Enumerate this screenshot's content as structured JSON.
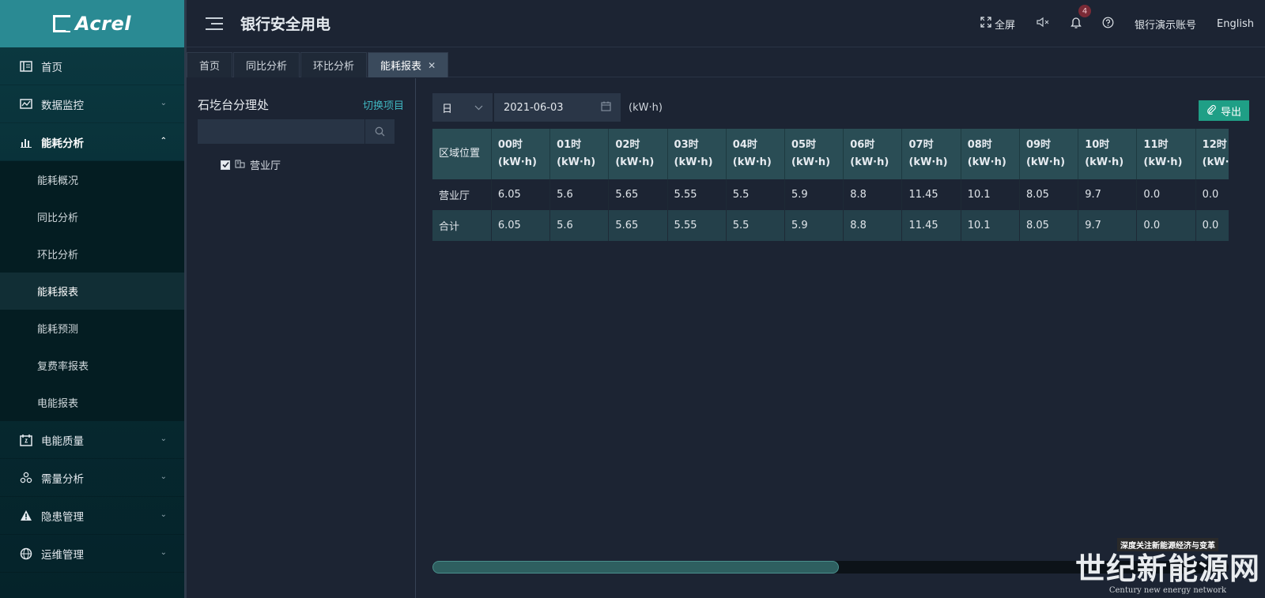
{
  "brand": {
    "logo_text": "Acrel"
  },
  "header": {
    "title": "银行安全用电",
    "fullscreen_label": "全屏",
    "notification_count": "4",
    "account_label": "银行演示账号",
    "language_label": "English"
  },
  "sidebar": {
    "items": [
      {
        "label": "首页",
        "icon": "home-icon"
      },
      {
        "label": "数据监控",
        "icon": "monitor-icon"
      },
      {
        "label": "能耗分析",
        "icon": "bar-chart-icon"
      },
      {
        "label": "电能质量",
        "icon": "calendar-icon"
      },
      {
        "label": "需量分析",
        "icon": "nodes-icon"
      },
      {
        "label": "隐患管理",
        "icon": "warning-icon"
      },
      {
        "label": "运维管理",
        "icon": "globe-icon"
      }
    ],
    "sub_items": [
      "能耗概况",
      "同比分析",
      "环比分析",
      "能耗报表",
      "能耗预测",
      "复费率报表",
      "电能报表"
    ],
    "active_sub": "能耗报表"
  },
  "tabs": [
    {
      "label": "首页"
    },
    {
      "label": "同比分析"
    },
    {
      "label": "环比分析"
    },
    {
      "label": "能耗报表",
      "active": true
    }
  ],
  "tree": {
    "title": "石圪台分理处",
    "switch_label": "切换项目",
    "search_placeholder": "",
    "node_label": "营业厅"
  },
  "toolbar": {
    "period_value": "日",
    "date_value": "2021-06-03",
    "unit": "(kW·h)",
    "export_label": "导出"
  },
  "table": {
    "first_header": "区域位置",
    "hours": [
      "00时",
      "01时",
      "02时",
      "03时",
      "04时",
      "05时",
      "06时",
      "07时",
      "08时",
      "09时",
      "10时",
      "11时",
      "12时"
    ],
    "hour_unit": "(kW·h)",
    "rows": [
      {
        "name": "营业厅",
        "values": [
          "6.05",
          "5.6",
          "5.65",
          "5.55",
          "5.5",
          "5.9",
          "8.8",
          "11.45",
          "10.1",
          "8.05",
          "9.7",
          "0.0",
          "0.0"
        ]
      },
      {
        "name": "合计",
        "values": [
          "6.05",
          "5.6",
          "5.65",
          "5.55",
          "5.5",
          "5.9",
          "8.8",
          "11.45",
          "10.1",
          "8.05",
          "9.7",
          "0.0",
          "0.0"
        ]
      }
    ]
  },
  "scroll": {
    "horizontal_position_fraction": 0.0,
    "visible_fraction": 0.51
  },
  "watermark": {
    "top": "深度关注新能源经济与变革",
    "main": "世纪新能源网",
    "sub": "Century new energy network"
  },
  "colors": {
    "brand": "#2a8a93",
    "accent": "#3fb6c0",
    "export": "#1f9f86",
    "badge": "#7a2a36"
  }
}
